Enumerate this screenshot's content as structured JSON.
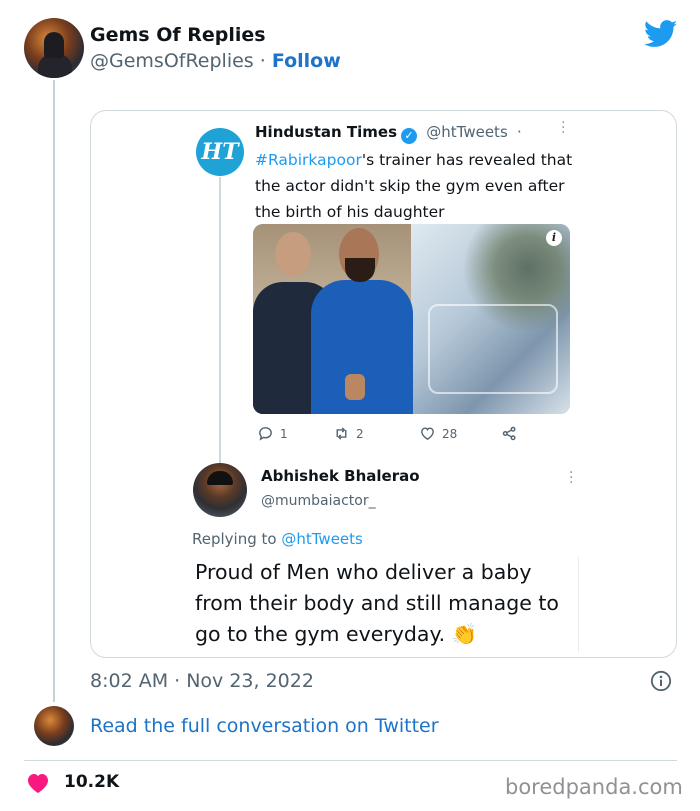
{
  "author": {
    "display_name": "Gems Of Replies",
    "handle": "@GemsOfReplies",
    "separator": "·",
    "follow_label": "Follow"
  },
  "quoted_tweet": {
    "logo_text": "HT",
    "name": "Hindustan Times",
    "handle": "@htTweets",
    "separator": "·",
    "hashtag": "#Rabirkapoor",
    "text_after_tag": "'s trainer has revealed that the actor didn't skip the gym even after the birth of his daughter",
    "info_badge": "i",
    "replies": "1",
    "retweets": "2",
    "likes": "28"
  },
  "reply_tweet": {
    "name": "Abhishek Bhalerao",
    "handle": "@mumbaiactor_",
    "replying_prefix": "Replying to",
    "replying_to": "@htTweets",
    "text": "Proud of Men who deliver a baby from their body and still manage to go to the gym everyday. 👏"
  },
  "timestamp": "8:02 AM · Nov 23, 2022",
  "read_full_label": "Read the full conversation on Twitter",
  "like_count": "10.2K",
  "watermark": "boredpanda.com",
  "colors": {
    "twitter_blue": "#1d9bf0",
    "link_blue": "#1d73c9",
    "heart_pink": "#f91880"
  }
}
